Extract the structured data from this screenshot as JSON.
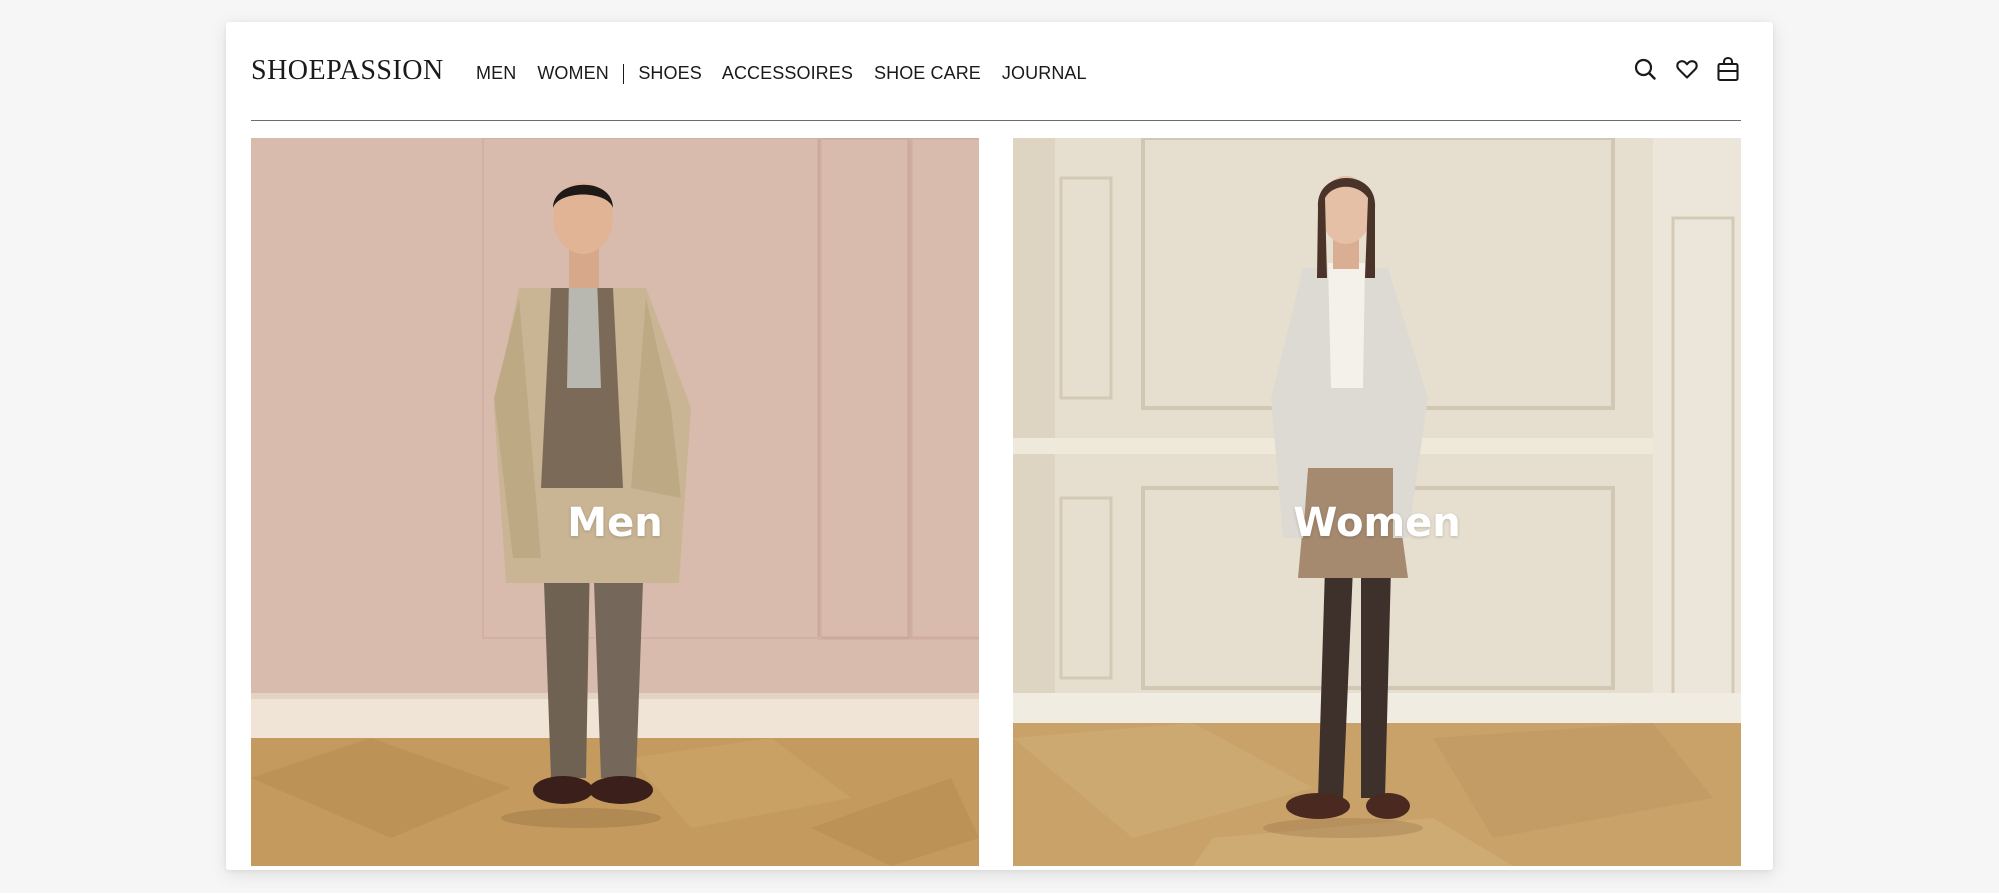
{
  "brand": {
    "logo_text": "SHOEPASSION"
  },
  "nav": {
    "items": [
      {
        "label": "MEN"
      },
      {
        "label": "WOMEN"
      },
      {
        "label": "SHOES"
      },
      {
        "label": "ACCESSOIRES"
      },
      {
        "label": "SHOE CARE"
      },
      {
        "label": "JOURNAL"
      }
    ]
  },
  "header_icons": [
    "search-icon",
    "heart-icon",
    "shopping-bag-icon"
  ],
  "tiles": [
    {
      "label": "Men",
      "background_color": "#dcbfb3"
    },
    {
      "label": "Women",
      "background_color": "#e6dfcf"
    }
  ],
  "colors": {
    "page_background": "#f6f6f6",
    "card_background": "#ffffff",
    "text": "#1a1a1a",
    "floor": "#c49a5e"
  }
}
